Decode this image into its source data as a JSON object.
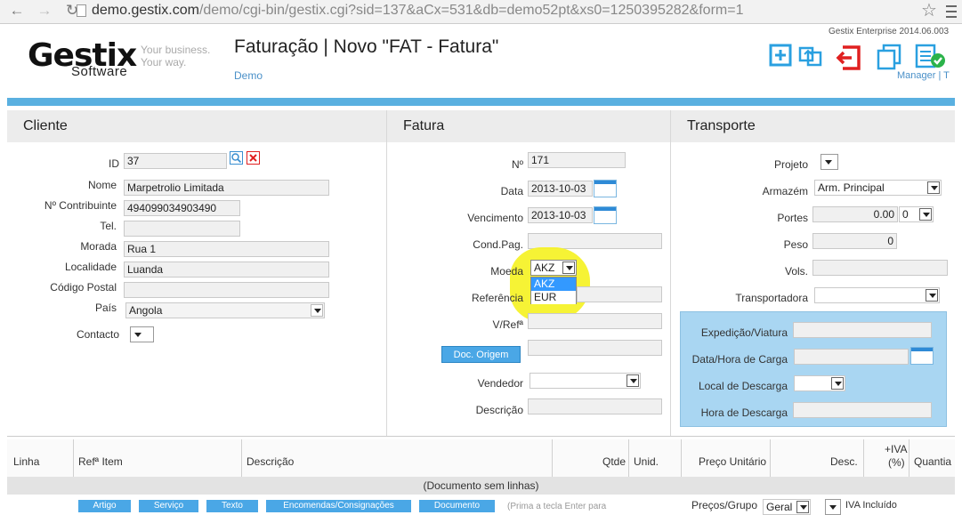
{
  "browser": {
    "url_host": "demo.gestix.com",
    "url_path": "/demo/cgi-bin/gestix.cgi?sid=137&aCx=531&db=demo52pt&xs0=1250395282&form=1"
  },
  "header": {
    "logo": "Gestix",
    "logo_sub": "Software",
    "tagline_1": "Your business.",
    "tagline_2": "Your way.",
    "title": "Faturação | Novo \"FAT - Fatura\"",
    "company": "Demo",
    "version": "Gestix Enterprise 2014.06.003",
    "user": "Manager | T"
  },
  "cliente": {
    "heading": "Cliente",
    "id_label": "ID",
    "id_value": "37",
    "nome_label": "Nome",
    "nome_value": "Marpetrolio Limitada",
    "nif_label": "Nº Contribuinte",
    "nif_value": "494099034903490",
    "tel_label": "Tel.",
    "tel_value": "",
    "morada_label": "Morada",
    "morada_value": "Rua 1",
    "localidade_label": "Localidade",
    "localidade_value": "Luanda",
    "cp_label": "Código Postal",
    "cp_value": "",
    "pais_label": "País",
    "pais_value": "Angola",
    "contacto_label": "Contacto"
  },
  "fatura": {
    "heading": "Fatura",
    "num_label": "Nº",
    "num_value": "171",
    "data_label": "Data",
    "data_value": "2013-10-03",
    "venc_label": "Vencimento",
    "venc_value": "2013-10-03",
    "cond_label": "Cond.Pag.",
    "moeda_label": "Moeda",
    "moeda_value": "AKZ",
    "moeda_options": [
      "AKZ",
      "EUR"
    ],
    "ref_label": "Referência",
    "vref_label": "V/Refª",
    "doc_origem": "Doc. Origem",
    "vendedor_label": "Vendedor",
    "descricao_label": "Descrição"
  },
  "transporte": {
    "heading": "Transporte",
    "projeto_label": "Projeto",
    "armazem_label": "Armazém",
    "armazem_value": "Arm. Principal",
    "portes_label": "Portes",
    "portes_value": "0.00",
    "portes_tax": "0",
    "peso_label": "Peso",
    "peso_value": "0",
    "vols_label": "Vols.",
    "transportadora_label": "Transportadora",
    "expedicao_label": "Expedição/Viatura",
    "carga_label": "Data/Hora de Carga",
    "local_descarga_label": "Local de Descarga",
    "hora_descarga_label": "Hora de Descarga"
  },
  "grid": {
    "columns": [
      "Linha",
      "Refª Item",
      "Descrição",
      "Qtde",
      "Unid.",
      "Preço Unitário",
      "Desc.",
      "+IVA",
      "(%)",
      "Quantia"
    ],
    "empty": "(Documento sem linhas)",
    "buttons": [
      "Artigo",
      "Serviço",
      "Texto",
      "Encomendas/Consignações",
      "Documento"
    ],
    "hint": "(Prima a tecla Enter para",
    "precos_label": "Preços/Grupo",
    "precos_value": "Geral",
    "iva_incluido": "IVA Incluído"
  },
  "colors": {
    "accent": "#5ab0e0",
    "highlight": "#f5f22a",
    "button": "#4aa7e6"
  },
  "icons": [
    "back-arrow-icon",
    "forward-arrow-icon",
    "reload-icon",
    "page-icon",
    "star-icon",
    "menu-icon",
    "search-icon",
    "delete-icon",
    "calendar-icon",
    "new-icon",
    "refresh-icon",
    "exit-icon",
    "copy-icon",
    "validate-icon"
  ]
}
